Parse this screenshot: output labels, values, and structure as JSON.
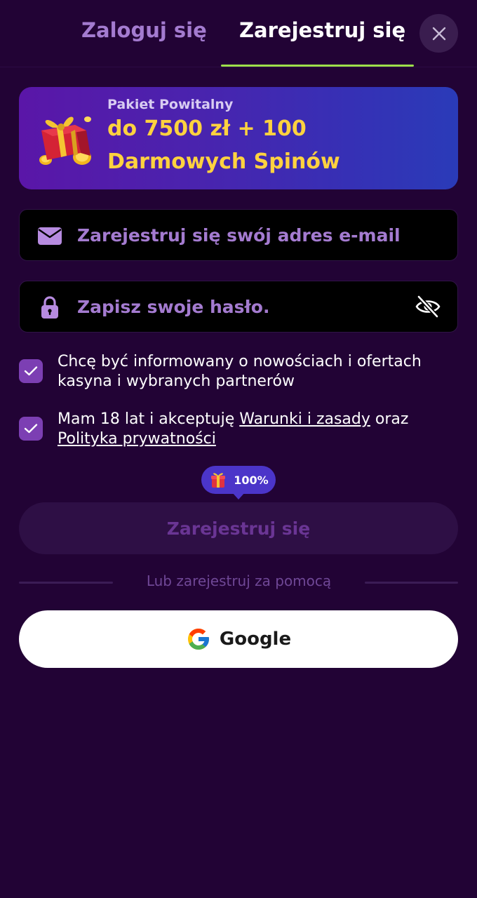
{
  "tabs": {
    "login": "Zaloguj się",
    "register": "Zarejestruj się"
  },
  "promo": {
    "subtitle": "Pakiet Powitalny",
    "line1": "do 7500 zł + 100",
    "line2": "Darmowych Spinów",
    "icon": "gift-box-icon"
  },
  "form": {
    "email_placeholder": "Zarejestruj się swój adres e-mail",
    "email_value": "",
    "password_placeholder": "Zapisz swoje hasło.",
    "password_value": ""
  },
  "consents": {
    "newsletter_text": "Chcę być informowany o nowościach i ofertach kasyna i wybranych partnerów",
    "newsletter_checked": true,
    "age_prefix": "Mam 18 lat i akceptuję ",
    "terms_link": "Warunki i zasady",
    "age_middle": " oraz ",
    "privacy_link": "Polityka prywatności",
    "age_checked": true
  },
  "bonus_badge": {
    "text": "100%"
  },
  "submit": {
    "label": "Zarejestruj się"
  },
  "divider": {
    "text": "Lub zarejestruj za pomocą"
  },
  "social": {
    "google_label": "Google"
  },
  "colors": {
    "background": "#220335",
    "accent_yellow": "#ffd23f",
    "tab_underline": "#9ee04a",
    "checkbox": "#7c3fb3",
    "placeholder": "#a47bd0"
  }
}
